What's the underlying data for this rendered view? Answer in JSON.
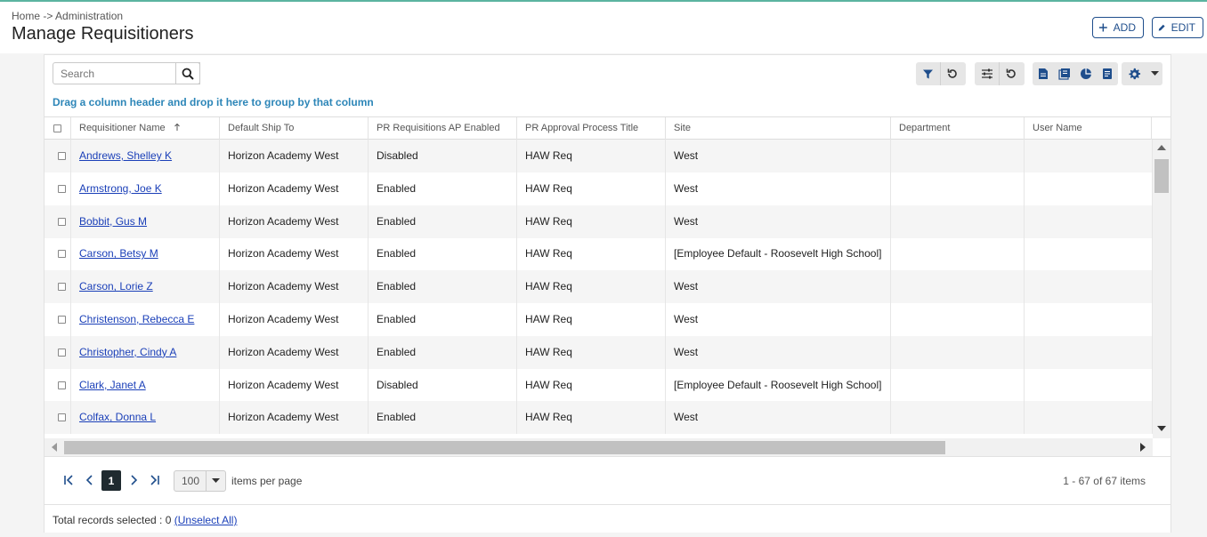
{
  "colors": {
    "accent": "#1f4e8c",
    "link": "#1a3fb8",
    "hint": "#2d86b8",
    "topline": "#5bb4a0"
  },
  "header": {
    "breadcrumb": "Home -> Administration",
    "title": "Manage Requisitioners",
    "add_label": "ADD",
    "edit_label": "EDIT"
  },
  "toolbar": {
    "search_placeholder": "Search",
    "icons": [
      "search-icon",
      "filter-icon",
      "reset-filter-icon",
      "column-settings-icon",
      "reset-columns-icon",
      "export-document-icon",
      "export-pdf-icon",
      "chart-icon",
      "report-icon",
      "gear-icon",
      "chevron-down-icon"
    ]
  },
  "group_hint": "Drag a column header and drop it here to group by that column",
  "columns": [
    {
      "label": "Requisitioner Name",
      "sort": "asc"
    },
    {
      "label": "Default Ship To"
    },
    {
      "label": "PR Requisitions AP Enabled"
    },
    {
      "label": "PR Approval Process Title"
    },
    {
      "label": "Site"
    },
    {
      "label": "Department"
    },
    {
      "label": "User Name"
    }
  ],
  "rows": [
    {
      "name": "Andrews, Shelley K",
      "ship_to": "Horizon Academy West",
      "ap_enabled": "Disabled",
      "approval": "HAW Req",
      "site": "West",
      "department": "",
      "user_name": ""
    },
    {
      "name": "Armstrong, Joe K",
      "ship_to": "Horizon Academy West",
      "ap_enabled": "Enabled",
      "approval": "HAW Req",
      "site": "West",
      "department": "",
      "user_name": ""
    },
    {
      "name": "Bobbit, Gus M",
      "ship_to": "Horizon Academy West",
      "ap_enabled": "Enabled",
      "approval": "HAW Req",
      "site": "West",
      "department": "",
      "user_name": ""
    },
    {
      "name": "Carson, Betsy M",
      "ship_to": "Horizon Academy West",
      "ap_enabled": "Enabled",
      "approval": "HAW Req",
      "site": "[Employee Default - Roosevelt High School]",
      "department": "",
      "user_name": ""
    },
    {
      "name": "Carson, Lorie Z",
      "ship_to": "Horizon Academy West",
      "ap_enabled": "Enabled",
      "approval": "HAW Req",
      "site": "West",
      "department": "",
      "user_name": ""
    },
    {
      "name": "Christenson, Rebecca E",
      "ship_to": "Horizon Academy West",
      "ap_enabled": "Enabled",
      "approval": "HAW Req",
      "site": "West",
      "department": "",
      "user_name": ""
    },
    {
      "name": "Christopher, Cindy A",
      "ship_to": "Horizon Academy West",
      "ap_enabled": "Enabled",
      "approval": "HAW Req",
      "site": "West",
      "department": "",
      "user_name": ""
    },
    {
      "name": "Clark, Janet A",
      "ship_to": "Horizon Academy West",
      "ap_enabled": "Disabled",
      "approval": "HAW Req",
      "site": "[Employee Default - Roosevelt High School]",
      "department": "",
      "user_name": ""
    },
    {
      "name": "Colfax, Donna L",
      "ship_to": "Horizon Academy West",
      "ap_enabled": "Enabled",
      "approval": "HAW Req",
      "site": "West",
      "department": "",
      "user_name": ""
    }
  ],
  "pager": {
    "current_page": "1",
    "page_size": "100",
    "items_per_page_label": "items per page",
    "range_text": "1 - 67 of 67 items"
  },
  "footer": {
    "selected_text": "Total records selected : 0",
    "unselect_label": "(Unselect All)"
  }
}
